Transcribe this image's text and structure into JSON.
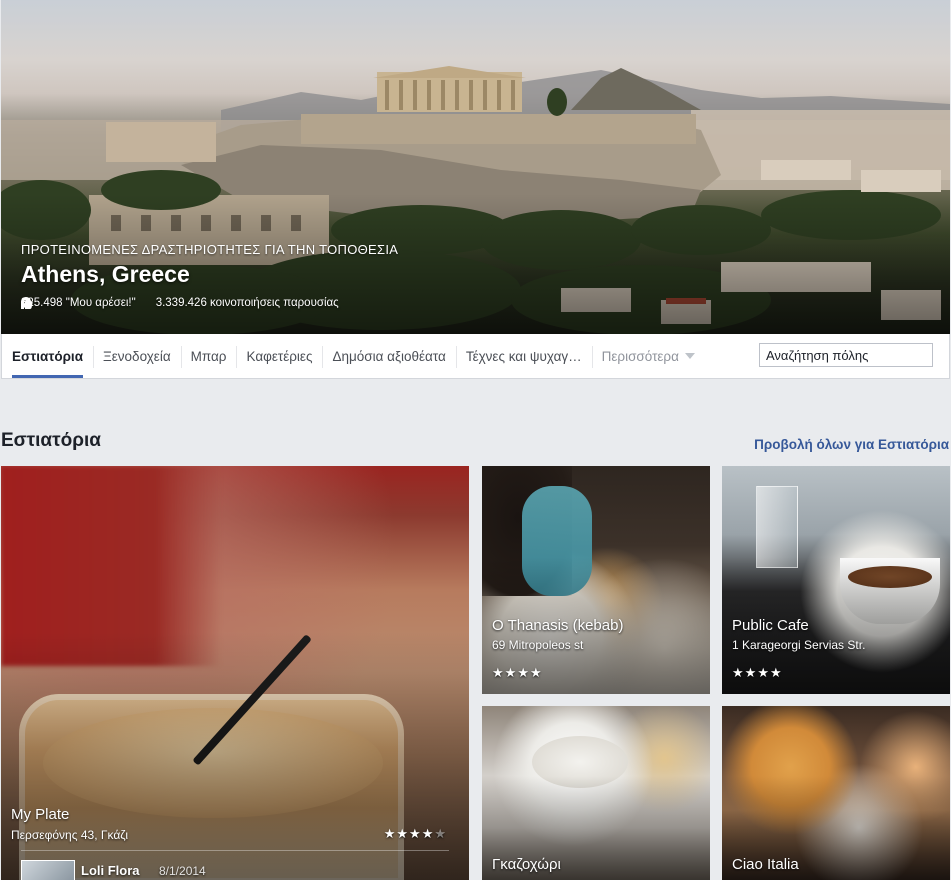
{
  "cover": {
    "subtitle": "ΠΡΟΤΕΙΝΟΜΕΝΕΣ ΔΡΑΣΤΗΡΙΟΤΗΤΕΣ ΓΙΑ ΤΗΝ ΤΟΠΟΘΕΣΙΑ",
    "title": "Athens, Greece",
    "likes": "325.498 \"Μου αρέσει!\"",
    "checkins": "3.339.426 κοινοποιήσεις παρουσίας"
  },
  "tabs": [
    {
      "label": "Εστιατόρια",
      "active": true
    },
    {
      "label": "Ξενοδοχεία"
    },
    {
      "label": "Μπαρ"
    },
    {
      "label": "Καφετέριες"
    },
    {
      "label": "Δημόσια αξιοθέατα"
    },
    {
      "label": "Τέχνες και ψυχαγ…"
    }
  ],
  "more_label": "Περισσότερα",
  "search": {
    "value": "Αναζήτηση πόλης"
  },
  "section": {
    "title": "Εστιατόρια",
    "see_all": "Προβολή όλων για Εστιατόρια"
  },
  "places": [
    {
      "name": "My Plate",
      "address": "Περσεφόνης 43, Γκάζι",
      "stars": 4,
      "user": "Loli Flora",
      "date": "8/1/2014"
    },
    {
      "name": "O Thanasis (kebab)",
      "address": "69 Mitropoleos st",
      "stars": 4
    },
    {
      "name": "Public Cafe",
      "address": "1 Karageorgi Servias Str.",
      "stars": 4
    },
    {
      "name": "Γκαζοχώρι"
    },
    {
      "name": "Ciao Italia"
    }
  ],
  "colors": {
    "accent": "#4267b2",
    "link": "#365899",
    "background": "#e9ebee"
  },
  "icons": {
    "likes": "thumbs-up-icon",
    "checkins": "map-pin-icon",
    "more": "caret-down-icon"
  }
}
